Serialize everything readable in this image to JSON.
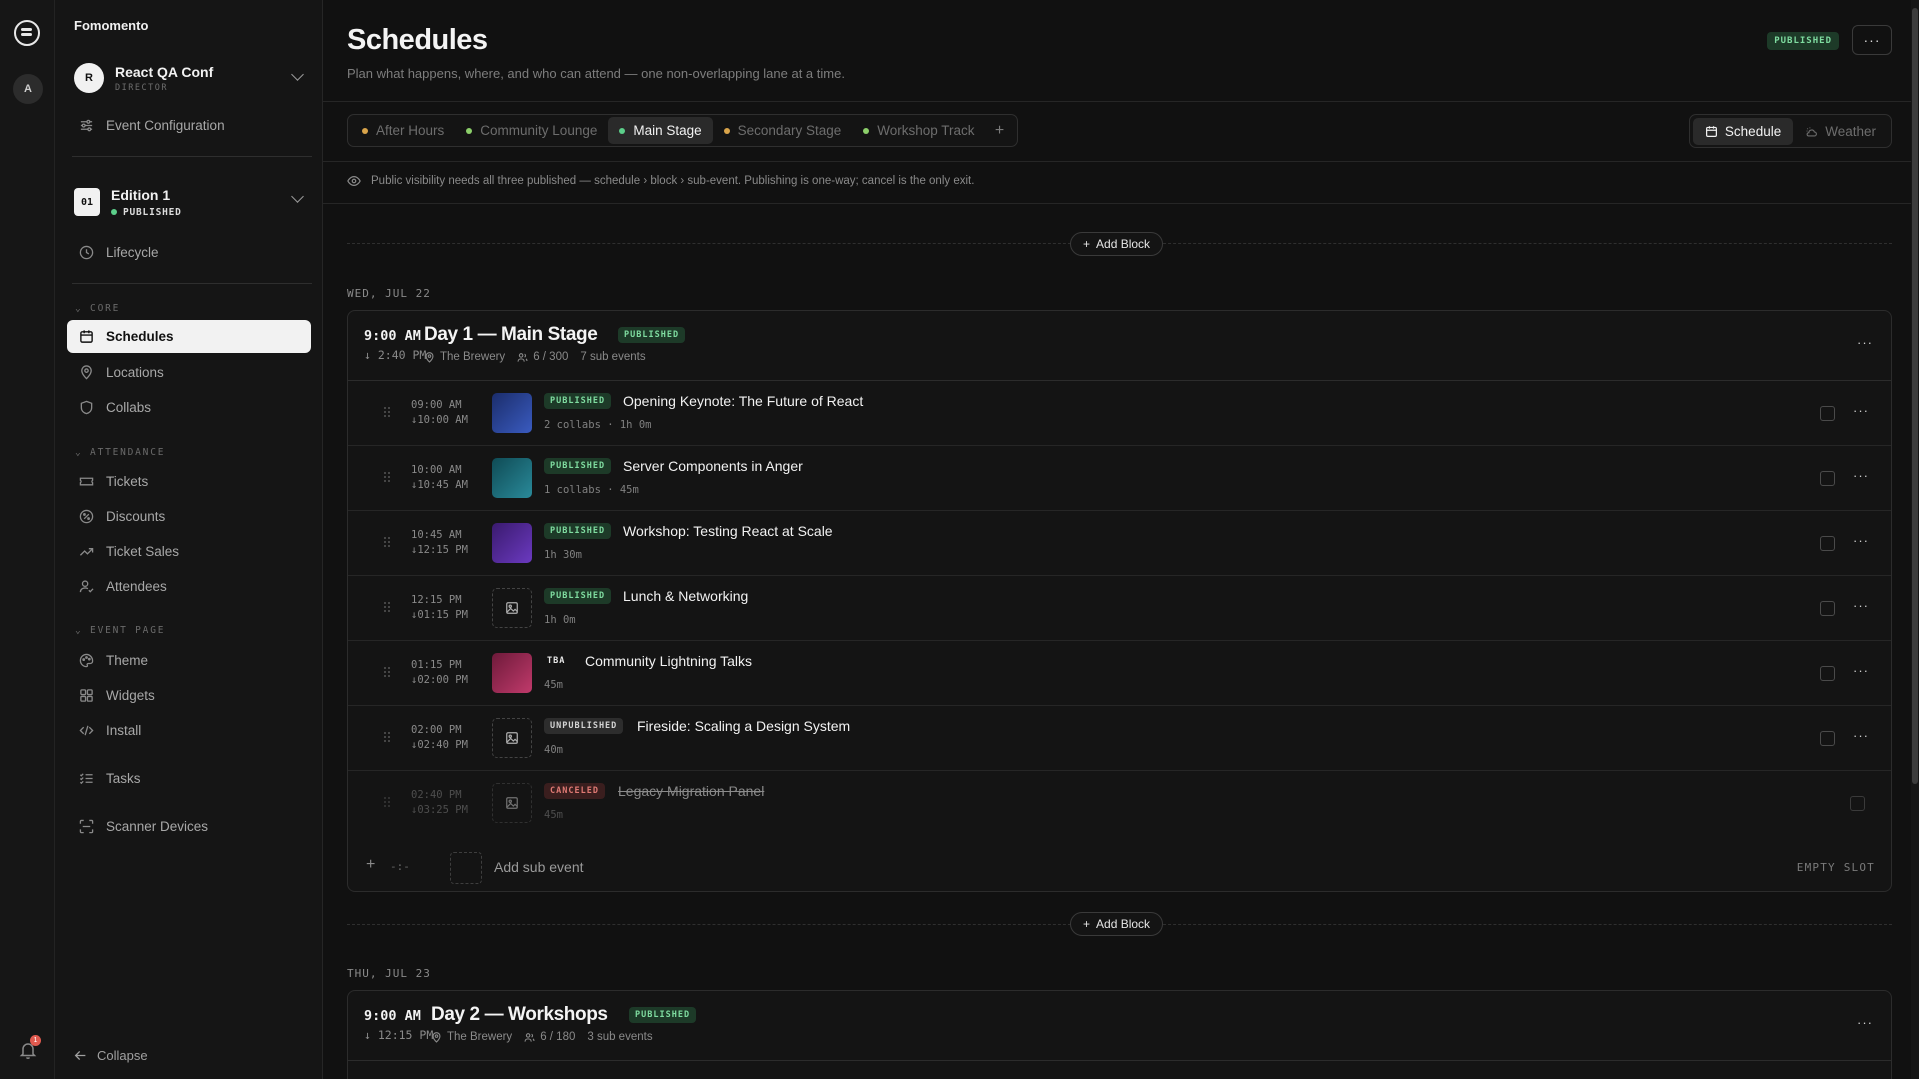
{
  "brand": "Fomomento",
  "rail": {
    "avatar": "A",
    "notification_count": "1"
  },
  "org": {
    "initial": "R",
    "name": "React QA Conf",
    "role": "DIRECTOR"
  },
  "nav_top": {
    "event_config": "Event Configuration",
    "lifecycle": "Lifecycle"
  },
  "edition": {
    "badge": "01",
    "name": "Edition 1",
    "status": "PUBLISHED"
  },
  "sections": {
    "core": "CORE",
    "attendance": "ATTENDANCE",
    "event_page": "EVENT PAGE"
  },
  "nav": {
    "schedules": "Schedules",
    "locations": "Locations",
    "collabs": "Collabs",
    "tickets": "Tickets",
    "discounts": "Discounts",
    "ticket_sales": "Ticket Sales",
    "attendees": "Attendees",
    "theme": "Theme",
    "widgets": "Widgets",
    "install": "Install",
    "tasks": "Tasks",
    "scanner_devices": "Scanner Devices",
    "collapse": "Collapse"
  },
  "header": {
    "title": "Schedules",
    "subtitle": "Plan what happens, where, and who can attend — one non-overlapping lane at a time.",
    "status": "PUBLISHED",
    "more": "···"
  },
  "tabs": [
    {
      "label": "After Hours",
      "color": "#d9a44a"
    },
    {
      "label": "Community Lounge",
      "color": "#8ccf6a"
    },
    {
      "label": "Main Stage",
      "color": "#5ccf8a"
    },
    {
      "label": "Secondary Stage",
      "color": "#d9a44a"
    },
    {
      "label": "Workshop Track",
      "color": "#8ccf6a"
    }
  ],
  "tab_add": "+",
  "view_switch": {
    "schedule": "Schedule",
    "weather": "Weather"
  },
  "notice": "Public visibility needs all three published — schedule › block › sub-event. Publishing is one-way; cancel is the only exit.",
  "add_block": "Add Block",
  "day1": {
    "date": "WED, JUL 22",
    "start": "9:00 AM",
    "end": "2:40 PM",
    "title": "Day 1 — Main Stage",
    "status": "PUBLISHED",
    "location": "The Brewery",
    "capacity": "6 / 300",
    "sub_count": "7 sub events",
    "more": "···",
    "rows": [
      {
        "start": "09:00 AM",
        "end": "10:00 AM",
        "status": "PUBLISHED",
        "title": "Opening Keynote: The Future of React",
        "meta": "2 collabs · 1h 0m"
      },
      {
        "start": "10:00 AM",
        "end": "10:45 AM",
        "status": "PUBLISHED",
        "title": "Server Components in Anger",
        "meta": "1 collabs · 45m"
      },
      {
        "start": "10:45 AM",
        "end": "12:15 PM",
        "status": "PUBLISHED",
        "title": "Workshop: Testing React at Scale",
        "meta": "1h 30m"
      },
      {
        "start": "12:15 PM",
        "end": "01:15 PM",
        "status": "PUBLISHED",
        "title": "Lunch & Networking",
        "meta": "1h 0m"
      },
      {
        "start": "01:15 PM",
        "end": "02:00 PM",
        "status": "TBA",
        "title": "Community Lightning Talks",
        "meta": "45m"
      },
      {
        "start": "02:00 PM",
        "end": "02:40 PM",
        "status": "UNPUBLISHED",
        "title": "Fireside: Scaling a Design System",
        "meta": "40m"
      },
      {
        "start": "02:40 PM",
        "end": "03:25 PM",
        "status": "CANCELED",
        "title": "Legacy Migration Panel",
        "meta": "45m"
      }
    ],
    "add_row": {
      "time": "-:-",
      "label": "Add sub event",
      "slot": "EMPTY SLOT"
    }
  },
  "day2": {
    "date": "THU, JUL 23",
    "start": "9:00 AM",
    "end": "12:15 PM",
    "title": "Day 2 — Workshops",
    "status": "PUBLISHED",
    "location": "The Brewery",
    "capacity": "6 / 180",
    "sub_count": "3 sub events",
    "more": "···"
  },
  "colors": {
    "published_text": "#7fdca0",
    "canceled_text": "#e07a74",
    "background": "#111111"
  }
}
